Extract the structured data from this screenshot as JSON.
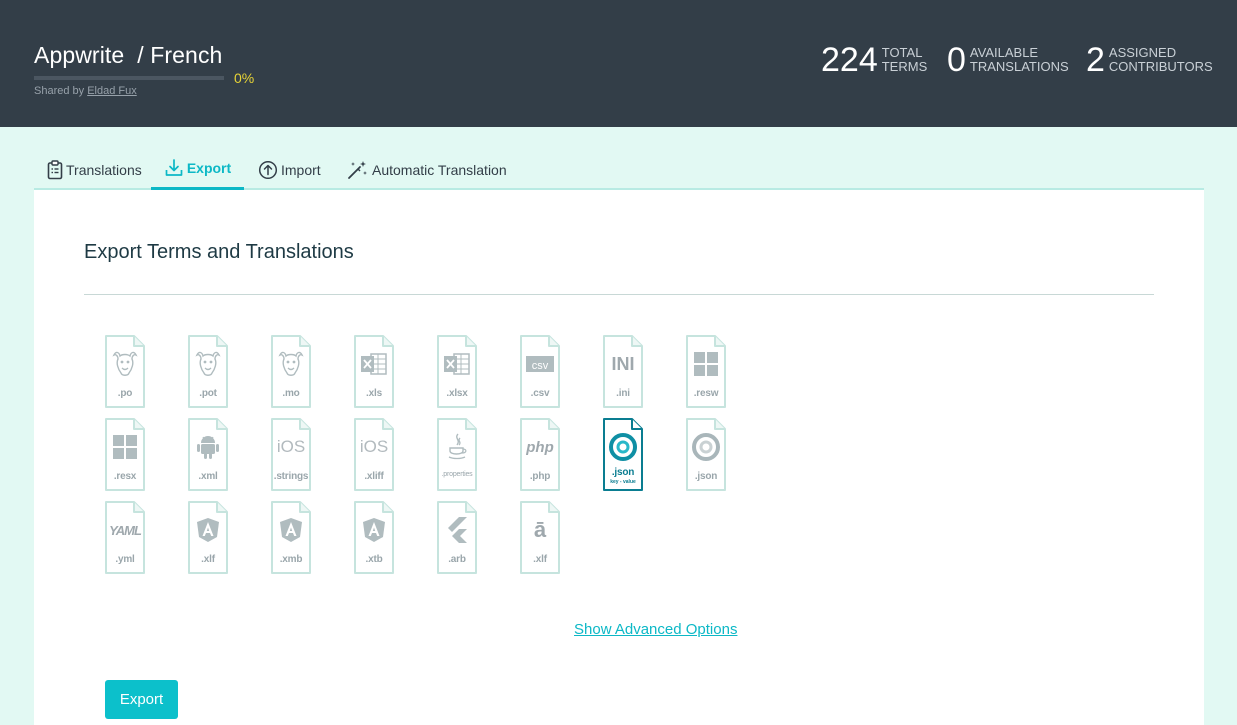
{
  "header": {
    "project": "Appwrite",
    "language": "/ French",
    "progress_percent": 0,
    "progress_label": "0%",
    "shared_prefix": "Shared by ",
    "shared_user": "Eldad Fux",
    "stats": [
      {
        "value": "224",
        "label_line1": "TOTAL",
        "label_line2": "TERMS"
      },
      {
        "value": "0",
        "label_line1": "AVAILABLE",
        "label_line2": "TRANSLATIONS"
      },
      {
        "value": "2",
        "label_line1": "ASSIGNED",
        "label_line2": "CONTRIBUTORS"
      }
    ]
  },
  "tabs": [
    {
      "label": "Translations",
      "icon": "clipboard-list-icon"
    },
    {
      "label": "Export",
      "icon": "download-tray-icon"
    },
    {
      "label": "Import",
      "icon": "upload-circle-icon"
    },
    {
      "label": "Automatic Translation",
      "icon": "magic-wand-icon"
    }
  ],
  "active_tab": "Export",
  "panel": {
    "title": "Export Terms and Translations",
    "formats": [
      {
        "ext": ".po",
        "icon": "gnu-icon"
      },
      {
        "ext": ".pot",
        "icon": "gnu-icon"
      },
      {
        "ext": ".mo",
        "icon": "gnu-icon"
      },
      {
        "ext": ".xls",
        "icon": "excel-icon"
      },
      {
        "ext": ".xlsx",
        "icon": "excel-icon"
      },
      {
        "ext": ".csv",
        "icon": "csv-icon",
        "glyph": "csv"
      },
      {
        "ext": ".ini",
        "icon": "ini-icon",
        "glyph": "INI"
      },
      {
        "ext": ".resw",
        "icon": "windows-icon"
      },
      {
        "ext": ".resx",
        "icon": "windows-icon"
      },
      {
        "ext": ".xml",
        "icon": "android-icon"
      },
      {
        "ext": ".strings",
        "icon": "ios-icon",
        "glyph": "iOS"
      },
      {
        "ext": ".xliff",
        "icon": "ios-icon",
        "glyph": "iOS"
      },
      {
        "ext": ".properties",
        "icon": "java-icon"
      },
      {
        "ext": ".php",
        "icon": "php-icon",
        "glyph": "php"
      },
      {
        "ext": ".json",
        "icon": "json-icon",
        "sub": "key - value",
        "selected": true
      },
      {
        "ext": ".json",
        "icon": "json-icon"
      },
      {
        "ext": ".yml",
        "icon": "yaml-icon",
        "glyph": "YAML"
      },
      {
        "ext": ".xlf",
        "icon": "angular-icon"
      },
      {
        "ext": ".xmb",
        "icon": "angular-icon"
      },
      {
        "ext": ".xtb",
        "icon": "angular-icon"
      },
      {
        "ext": ".arb",
        "icon": "flutter-icon"
      },
      {
        "ext": ".xlf",
        "icon": "a-macron-icon",
        "glyph": "ā"
      }
    ],
    "advanced_link": "Show Advanced Options",
    "export_button": "Export"
  },
  "colors": {
    "header_bg": "#333e48",
    "accent": "#0cb8c6",
    "progress": "#e8d436",
    "page_bg": "#e2f9f3",
    "icon_outline": "#c5e3dd"
  }
}
